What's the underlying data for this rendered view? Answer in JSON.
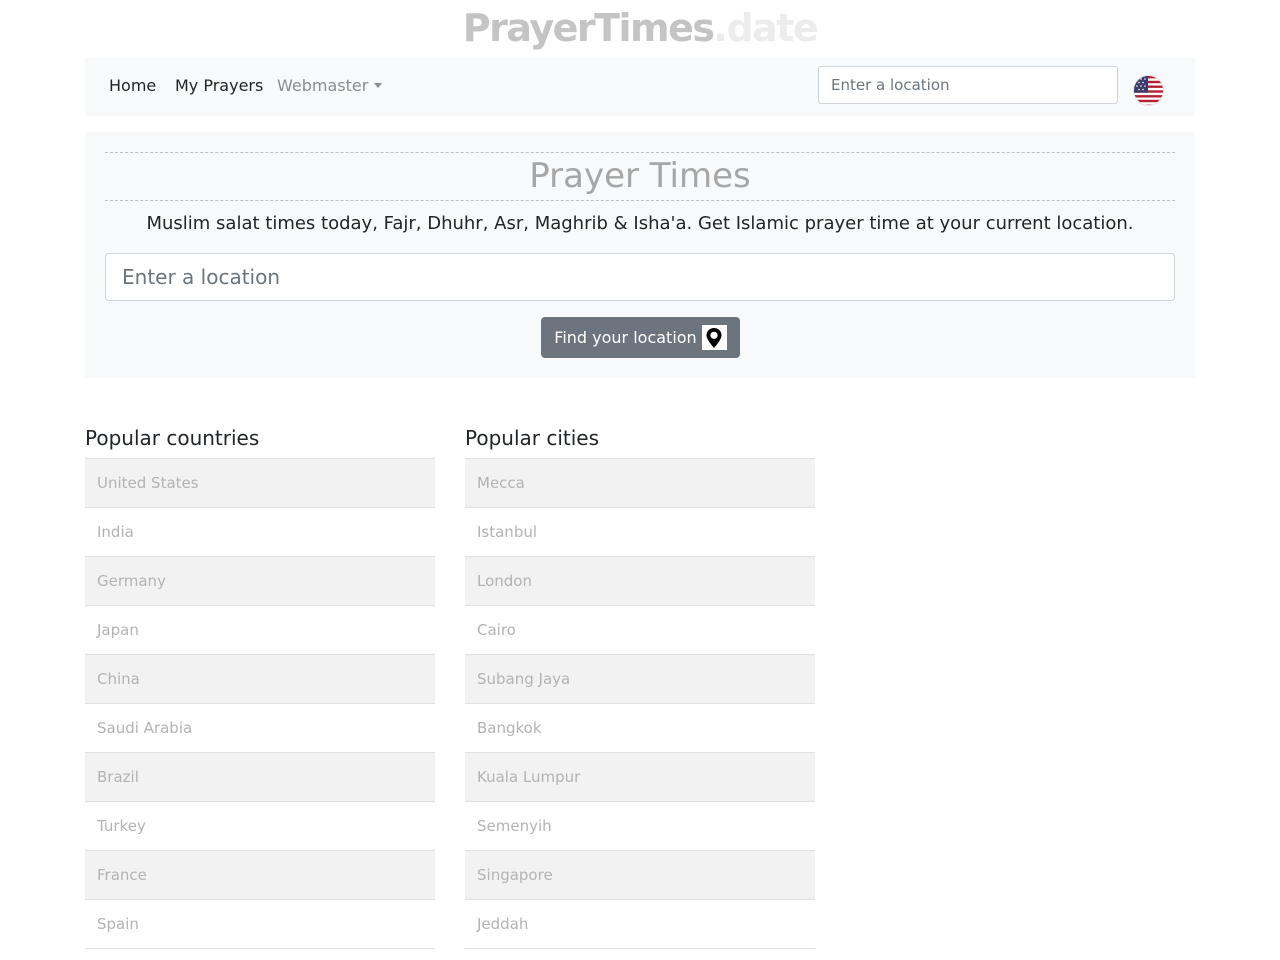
{
  "logo": {
    "main": "PrayerTimes",
    "tld": ".date"
  },
  "nav": {
    "home": "Home",
    "my_prayers": "My Prayers",
    "webmaster": "Webmaster",
    "search_placeholder": "Enter a location",
    "flag_icon": "us-flag-icon"
  },
  "hero": {
    "title": "Prayer Times",
    "subtitle": "Muslim salat times today, Fajr, Dhuhr, Asr, Maghrib & Isha'a. Get Islamic prayer time at your current location.",
    "search_placeholder": "Enter a location",
    "find_button": "Find your location",
    "find_icon": "map-pin-icon"
  },
  "popular_countries": {
    "heading": "Popular countries",
    "items": [
      "United States",
      "India",
      "Germany",
      "Japan",
      "China",
      "Saudi Arabia",
      "Brazil",
      "Turkey",
      "France",
      "Spain"
    ]
  },
  "popular_cities": {
    "heading": "Popular cities",
    "items": [
      "Mecca",
      "Istanbul",
      "London",
      "Cairo",
      "Subang Jaya",
      "Bangkok",
      "Kuala Lumpur",
      "Semenyih",
      "Singapore",
      "Jeddah"
    ]
  },
  "colors": {
    "panel": "#f8f9fa",
    "button": "#6c757d",
    "stripe": "#f2f2f2",
    "list_text": "#b3b3b3",
    "logo_main": "#c4c4c4",
    "logo_tld": "#ececec"
  }
}
